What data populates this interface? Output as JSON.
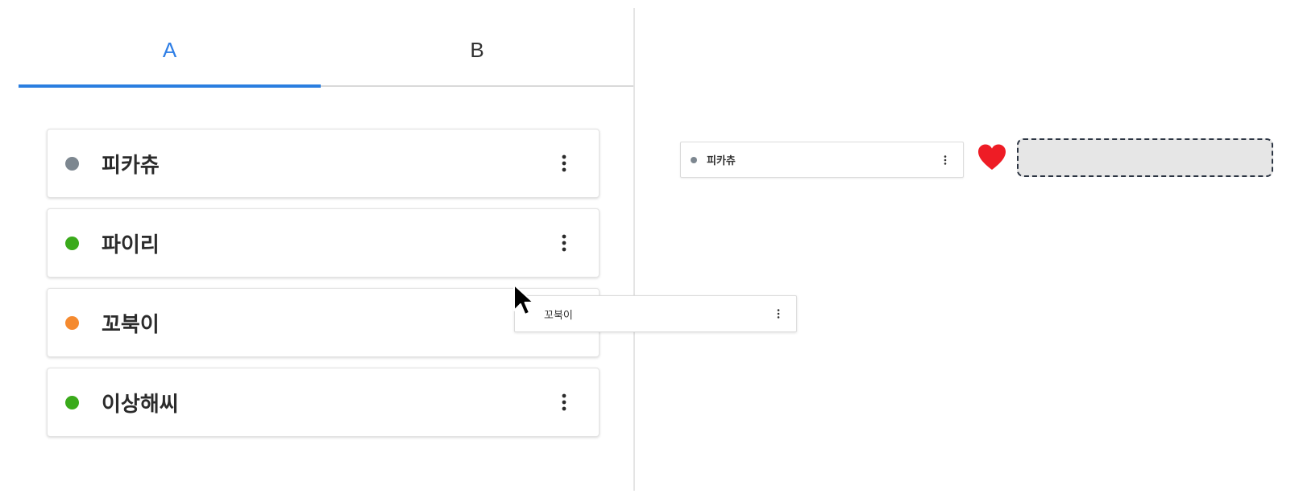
{
  "tabs": [
    {
      "label": "A",
      "active": true
    },
    {
      "label": "B",
      "active": false
    }
  ],
  "list": {
    "items": [
      {
        "name": "피카츄",
        "status_color": "#7d8790"
      },
      {
        "name": "파이리",
        "status_color": "#3aaa1b"
      },
      {
        "name": "꼬북이",
        "status_color": "#f58a2f"
      },
      {
        "name": "이상해씨",
        "status_color": "#3aaa1b"
      }
    ]
  },
  "dropped": {
    "name": "피카츄",
    "status_color": "#7d8790"
  },
  "drag_ghost": {
    "name": "꼬북이"
  },
  "icons": {
    "menu": "kebab-vertical-icon",
    "heart": "heart-icon",
    "cursor": "mouse-pointer-icon"
  },
  "colors": {
    "accent": "#2a7ee0",
    "heart": "#ee1c25",
    "slot_border": "#2b3442",
    "slot_fill": "#e6e6e6"
  }
}
